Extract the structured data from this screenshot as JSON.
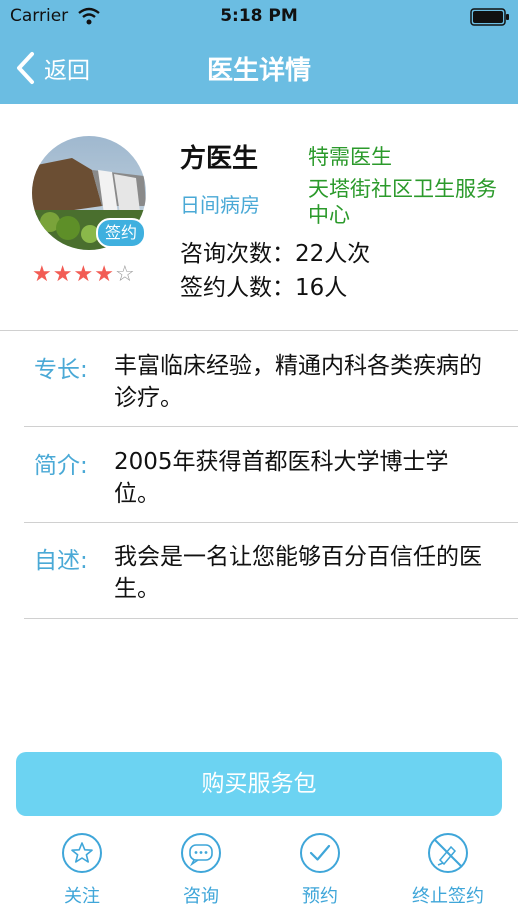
{
  "status_bar": {
    "carrier": "Carrier",
    "time": "5:18 PM"
  },
  "nav": {
    "back_label": "返回",
    "title": "医生详情"
  },
  "doctor": {
    "name": "方医生",
    "title": "特需医生",
    "department": "日间病房",
    "hospital": "天塔街社区卫生服务中心",
    "sign_badge": "签约",
    "rating": 4,
    "rating_max": 5,
    "consult_count": "咨询次数：22人次",
    "sign_count": "签约人数：16人"
  },
  "info": [
    {
      "label": "专长:",
      "text": "丰富临床经验，精通内科各类疾病的诊疗。"
    },
    {
      "label": "简介:",
      "text": "2005年获得首都医科大学博士学位。"
    },
    {
      "label": "自述:",
      "text": "我会是一名让您能够百分百信任的医生。"
    }
  ],
  "buy_button": "购买服务包",
  "tabs": [
    {
      "label": "关注",
      "icon": "star-icon"
    },
    {
      "label": "咨询",
      "icon": "chat-icon"
    },
    {
      "label": "预约",
      "icon": "check-icon"
    },
    {
      "label": "终止签约",
      "icon": "stop-sign-icon"
    }
  ],
  "colors": {
    "header": "#6bbde2",
    "accent": "#3fa6d9",
    "green": "#2b9a2b",
    "button": "#6cd3f2",
    "star": "#f25c54"
  }
}
